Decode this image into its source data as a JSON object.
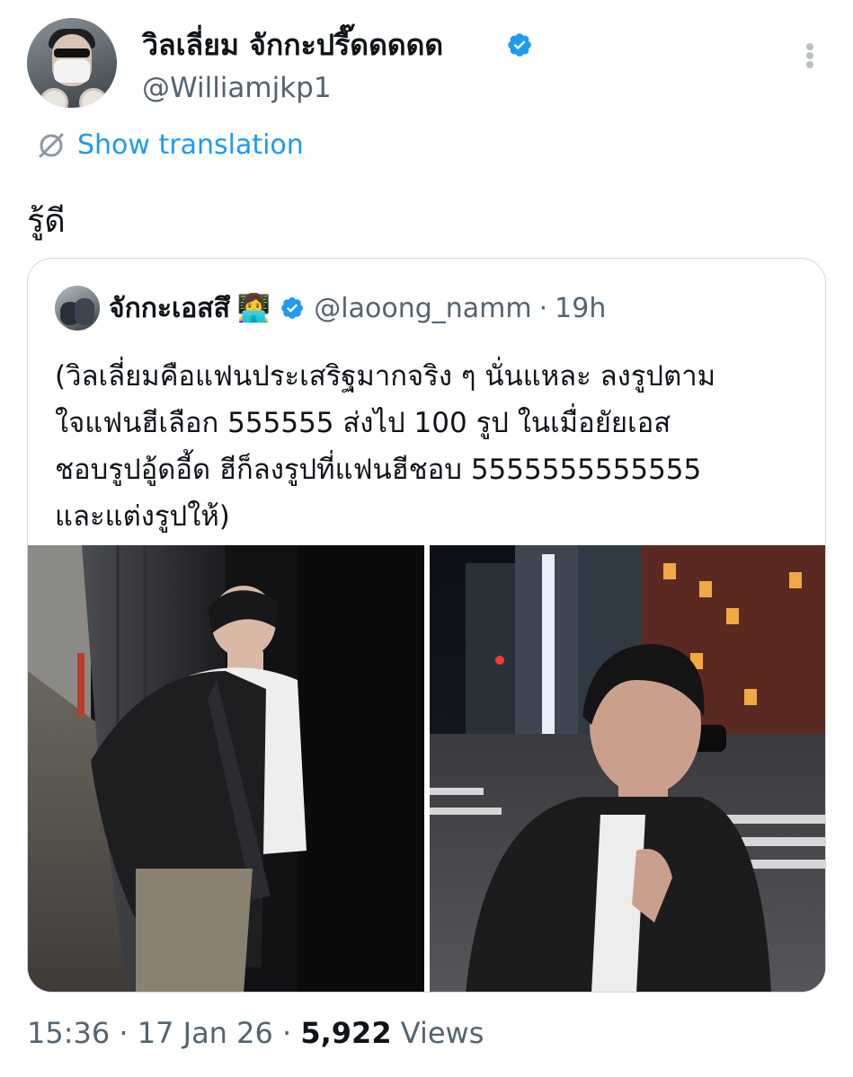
{
  "tweet": {
    "display_name": "วิลเลี่ยม จักกะปรี๊ดดดดด",
    "handle": "@Williamjkp1",
    "translate_label": "Show translation",
    "text": "รู้ดี",
    "timestamp": "15:36 · 17 Jan 26 · ",
    "views_count": "5,922",
    "views_label": " Views"
  },
  "quote": {
    "display_name": "จักกะเอสสึ",
    "emoji": "👩‍💻",
    "handle": "@laoong_namm",
    "separator": "·",
    "time": "19h",
    "text": "(วิลเลี่ยมคือแฟนประเสริฐมากจริง ๆ นั่นแหละ ลงรูปตาม\nใจแฟนฮีเลือก 555555 ส่งไป 100 รูป ในเมื่อยัยเอส\nชอบรูปอู้ดอี้ด ฮีก็ลงรูปที่แฟนฮีชอบ 5555555555555\nและแต่งรูปให้)"
  },
  "colors": {
    "accent": "#1d9bf0",
    "secondary_text": "#536471",
    "border": "#cfd9de"
  },
  "icons": [
    "verified-badge-icon",
    "more-icon",
    "translate-globe-icon"
  ]
}
